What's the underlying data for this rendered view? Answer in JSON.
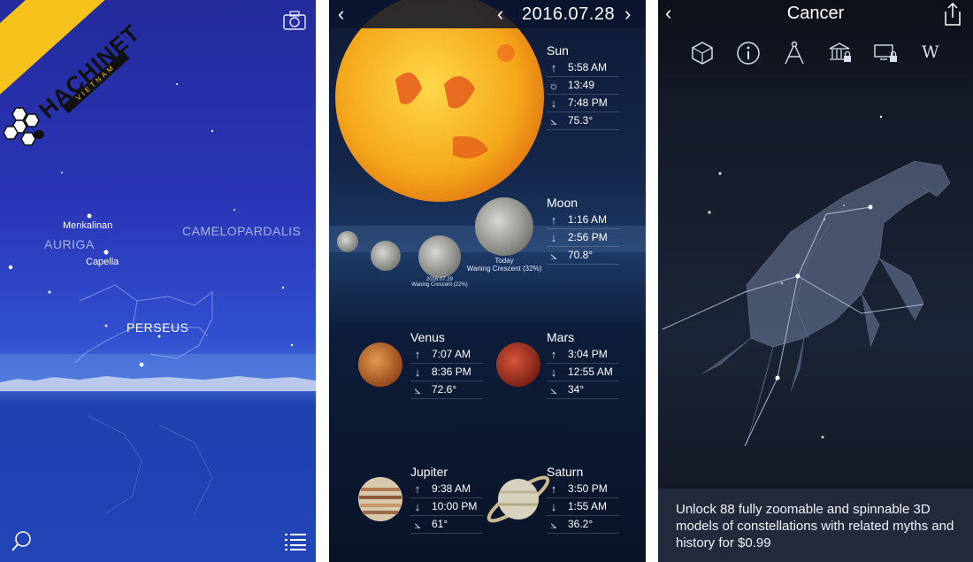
{
  "screen1": {
    "constellations": [
      "AURIGA",
      "CAMELOPARDALIS",
      "PERSEUS"
    ],
    "stars": [
      "Menkalinan",
      "Capella"
    ],
    "watermark": {
      "brand": "HACHINET",
      "sub": "VIETNAM"
    }
  },
  "screen2": {
    "date": "2016.07.28",
    "sun": {
      "name": "Sun",
      "rows": [
        {
          "icon": "rise-icon",
          "glyph": "↑",
          "value": "5:58 AM"
        },
        {
          "icon": "transit-sun-icon",
          "glyph": "☼",
          "value": "13:49"
        },
        {
          "icon": "set-icon",
          "glyph": "↓",
          "value": "7:48 PM"
        },
        {
          "icon": "altitude-icon",
          "glyph": "⦣",
          "value": "75.3°"
        }
      ]
    },
    "moon": {
      "name": "Moon",
      "rows": [
        {
          "icon": "rise-icon",
          "glyph": "↑",
          "value": "1:16 AM"
        },
        {
          "icon": "set-icon",
          "glyph": "↓",
          "value": "2:56 PM"
        },
        {
          "icon": "altitude-icon",
          "glyph": "⦣",
          "value": "70.8°"
        }
      ],
      "today_label": "Today",
      "today_phase": "Waning Crescent (32%)",
      "next_date": "2016.07.29",
      "next_phase": "Waning Crescent (22%)"
    },
    "venus": {
      "name": "Venus",
      "rows": [
        {
          "icon": "rise-icon",
          "glyph": "↑",
          "value": "7:07 AM"
        },
        {
          "icon": "set-icon",
          "glyph": "↓",
          "value": "8:36 PM"
        },
        {
          "icon": "altitude-icon",
          "glyph": "⦣",
          "value": "72.6°"
        }
      ]
    },
    "mars": {
      "name": "Mars",
      "rows": [
        {
          "icon": "rise-icon",
          "glyph": "↑",
          "value": "3:04 PM"
        },
        {
          "icon": "set-icon",
          "glyph": "↓",
          "value": "12:55 AM"
        },
        {
          "icon": "altitude-icon",
          "glyph": "⦣",
          "value": "34°"
        }
      ]
    },
    "jupiter": {
      "name": "Jupiter",
      "rows": [
        {
          "icon": "rise-icon",
          "glyph": "↑",
          "value": "9:38 AM"
        },
        {
          "icon": "set-icon",
          "glyph": "↓",
          "value": "10:00 PM"
        },
        {
          "icon": "altitude-icon",
          "glyph": "⦣",
          "value": "61°"
        }
      ]
    },
    "saturn": {
      "name": "Saturn",
      "rows": [
        {
          "icon": "rise-icon",
          "glyph": "↑",
          "value": "3:50 PM"
        },
        {
          "icon": "set-icon",
          "glyph": "↓",
          "value": "1:55 AM"
        },
        {
          "icon": "altitude-icon",
          "glyph": "⦣",
          "value": "36.2°"
        }
      ]
    }
  },
  "screen3": {
    "title": "Cancer",
    "toolbar_icons": [
      "3d-model-icon",
      "info-icon",
      "compass-icon",
      "museum-lock-icon",
      "screen-lock-icon",
      "wikipedia-icon"
    ],
    "wiki_glyph": "W",
    "caption": "Unlock 88 fully zoomable and spinnable 3D models of constellations with related myths and history for $0.99"
  },
  "colors": {
    "sky_blue": "#2a35b6",
    "banner_yellow": "#f7c21c",
    "night_navy": "#14264a",
    "dark_panel": "#141a28"
  }
}
